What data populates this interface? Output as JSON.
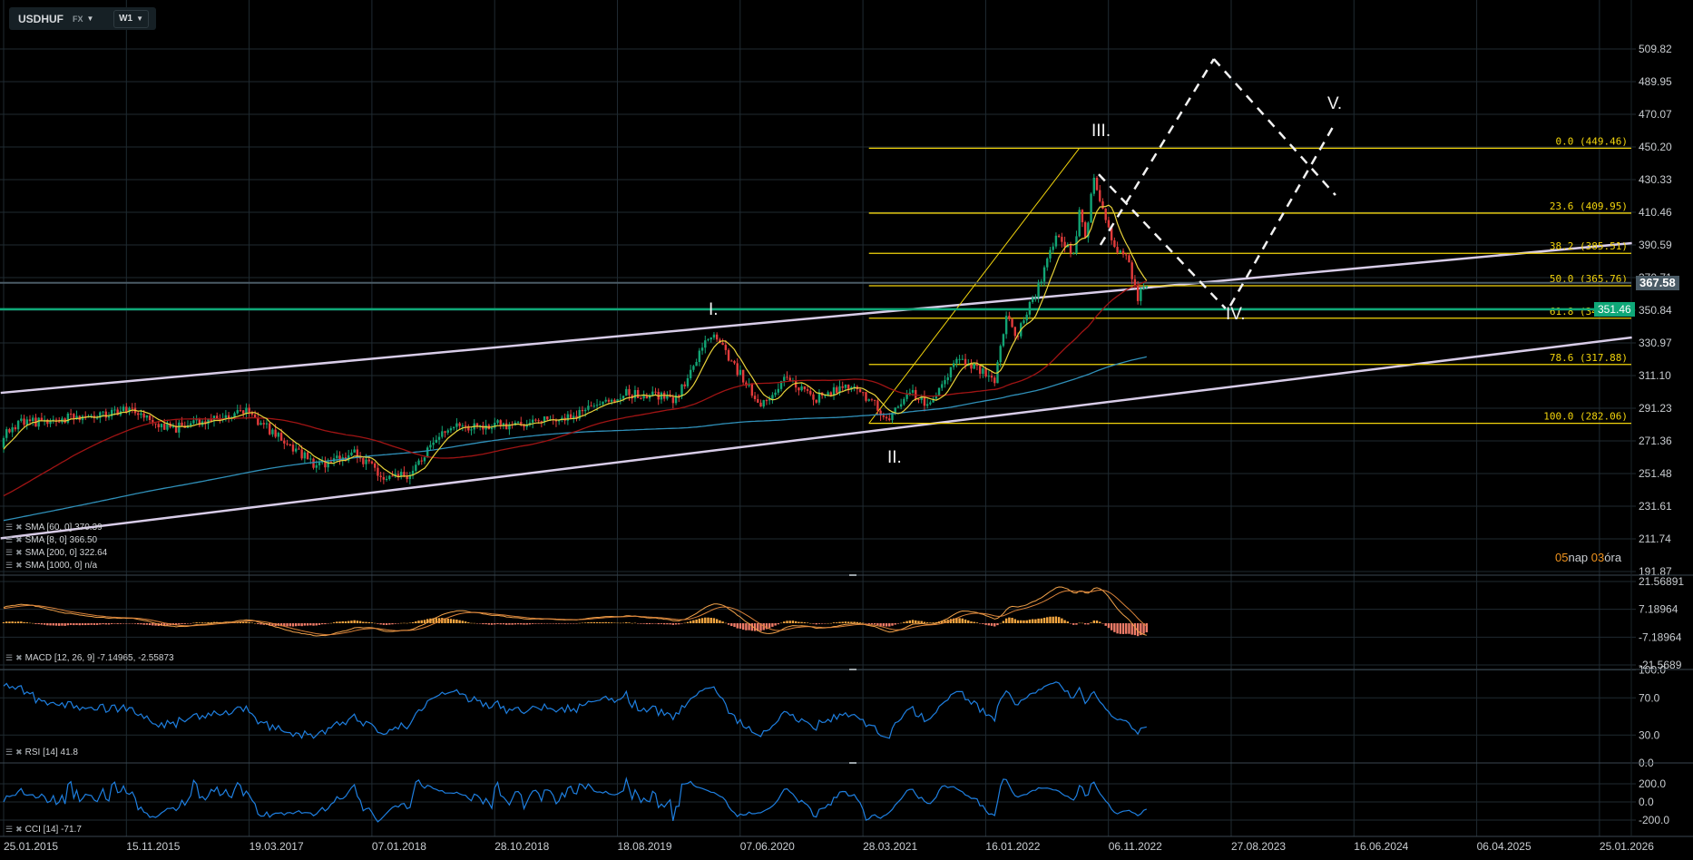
{
  "header": {
    "symbol": "USDHUF",
    "market": "FX",
    "timeframe": "W1"
  },
  "price_axis": {
    "ticks": [
      "509.82",
      "489.95",
      "470.07",
      "450.20",
      "430.33",
      "410.46",
      "390.59",
      "370.71",
      "350.84",
      "330.97",
      "311.10",
      "291.23",
      "271.36",
      "251.48",
      "231.61",
      "211.74",
      "191.87"
    ]
  },
  "macd_axis": {
    "ticks": [
      "21.56891",
      "7.18964",
      "-7.18964",
      "-21.5689"
    ]
  },
  "rsi_axis": {
    "ticks": [
      "100.0",
      "70.0",
      "30.0",
      "0.0"
    ]
  },
  "cci_axis": {
    "ticks": [
      "200.0",
      "0.0",
      "-200.0"
    ]
  },
  "time_axis": {
    "labels": [
      "25.01.2015",
      "15.11.2015",
      "19.03.2017",
      "07.01.2018",
      "28.10.2018",
      "18.08.2019",
      "07.06.2020",
      "28.03.2021",
      "16.01.2022",
      "06.11.2022",
      "27.08.2023",
      "16.06.2024",
      "06.04.2025",
      "25.01.2026"
    ]
  },
  "current_price": {
    "label": "367.58",
    "value": 367.58,
    "color": "#4a5b66"
  },
  "horizontal_line": {
    "label": "351.46",
    "value": 351.46,
    "color": "#0fa878"
  },
  "fibonacci": {
    "color": "#f2d40c",
    "levels": [
      {
        "label": "0.0 (449.46)",
        "value": 449.46
      },
      {
        "label": "23.6 (409.95)",
        "value": 409.95
      },
      {
        "label": "38.2 (385.51)",
        "value": 385.51
      },
      {
        "label": "50.0 (365.76)",
        "value": 365.76
      },
      {
        "label": "61.8 (346.01)",
        "value": 346.01
      },
      {
        "label": "78.6 (317.88)",
        "value": 317.88
      },
      {
        "label": "100.0 (282.06)",
        "value": 282.06
      }
    ]
  },
  "waves": [
    "I.",
    "II.",
    "III.",
    "IV.",
    "V."
  ],
  "legends": {
    "sma60": "SMA [60, 0] 370.39",
    "sma8": "SMA [8, 0] 366.50",
    "sma200": "SMA [200, 0] 322.64",
    "sma1000": "SMA [1000, 0] n/a",
    "macd": "MACD [12, 26, 9] -7.14965, -2.55873",
    "rsi": "RSI [14] 41.8",
    "cci": "CCI [14] -71.7"
  },
  "countdown": {
    "days": "05",
    "days_unit": "nap",
    "hours": "03",
    "hours_unit": "óra"
  },
  "colors": {
    "up": "#12a474",
    "down": "#e23b3b",
    "sma8": "#e8d23a",
    "sma60": "#a01414",
    "sma200": "#2f8fb8",
    "channel": "#d8cce8",
    "rsi": "#1e7fe0",
    "macd_pos": "#f4a640",
    "macd_neg": "#ef7b68"
  },
  "chart_data": {
    "type": "candlestick",
    "instrument": "USDHUF",
    "interval": "weekly",
    "close_keypoints_week_price": [
      [
        0,
        274.7
      ],
      [
        6,
        282
      ],
      [
        43,
        289.6
      ],
      [
        57,
        278.5
      ],
      [
        83,
        289.6
      ],
      [
        93,
        274.7
      ],
      [
        107,
        256.5
      ],
      [
        120,
        263.7
      ],
      [
        131,
        248.7
      ],
      [
        139,
        250.9
      ],
      [
        150,
        278.5
      ],
      [
        177,
        282
      ],
      [
        195,
        285.7
      ],
      [
        213,
        300.6
      ],
      [
        230,
        296.8
      ],
      [
        242,
        337
      ],
      [
        248,
        322.6
      ],
      [
        259,
        293
      ],
      [
        268,
        311.7
      ],
      [
        277,
        296.8
      ],
      [
        291,
        305.9
      ],
      [
        303,
        283.9
      ],
      [
        310,
        302
      ],
      [
        317,
        292.9
      ],
      [
        327,
        322.7
      ],
      [
        335,
        313.3
      ],
      [
        339,
        309.5
      ],
      [
        343,
        348
      ],
      [
        346,
        333.7
      ],
      [
        353,
        361.3
      ],
      [
        360,
        396
      ],
      [
        366,
        385
      ],
      [
        368,
        410.9
      ],
      [
        370,
        392.3
      ],
      [
        373,
        433.1
      ],
      [
        376,
        412.7
      ],
      [
        379,
        392.3
      ],
      [
        384,
        383.4
      ],
      [
        388,
        359.1
      ],
      [
        391,
        365
      ]
    ],
    "channel_upper_week_price": [
      [
        -1,
        300.6
      ],
      [
        557,
        391.7
      ]
    ],
    "channel_lower_week_price": [
      [
        -1,
        212.1
      ],
      [
        557,
        334.3
      ]
    ],
    "fib_trend_week_price": [
      [
        296,
        282.06
      ],
      [
        368,
        449.46
      ]
    ],
    "projection_dashed_week_price": [
      [
        [
          374.6,
          433.6
        ],
        [
          418,
          351.9
        ]
      ],
      [
        [
          375.2,
          390.6
        ],
        [
          414,
          503.7
        ]
      ],
      [
        [
          414,
          503.7
        ],
        [
          455.6,
          420.9
        ]
      ],
      [
        [
          419.6,
          353.6
        ],
        [
          454.7,
          462.3
        ]
      ]
    ],
    "price_range": [
      191.87,
      509.82
    ]
  }
}
